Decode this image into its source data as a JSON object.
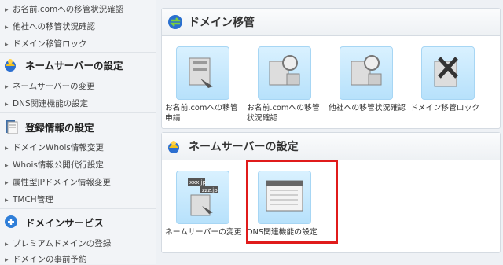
{
  "sidebar": {
    "top_items": [
      "お名前.comへの移管状況確認",
      "他社への移管状況確認",
      "ドメイン移管ロック"
    ],
    "sections": [
      {
        "heading": "ネームサーバーの設定",
        "items": [
          "ネームサーバーの変更",
          "DNS関連機能の設定"
        ]
      },
      {
        "heading": "登録情報の設定",
        "items": [
          "ドメインWhois情報変更",
          "Whois情報公開代行設定",
          "属性型JPドメイン情報変更",
          "TMCH管理"
        ]
      },
      {
        "heading": "ドメインサービス",
        "items": [
          "プレミアムドメインの登録",
          "ドメインの事前予約"
        ]
      }
    ]
  },
  "main": {
    "transfer": {
      "title": "ドメイン移管",
      "tiles": [
        {
          "label": "お名前.comへの移管申請"
        },
        {
          "label": "お名前.comへの移管状況確認"
        },
        {
          "label": "他社への移管状況確認"
        },
        {
          "label": "ドメイン移管ロック"
        }
      ]
    },
    "nameserver": {
      "title": "ネームサーバーの設定",
      "tiles": [
        {
          "label": "ネームサーバーの変更",
          "icon_text_1": "xxx.jp",
          "icon_text_2": "zzz.jp"
        },
        {
          "label": "DNS関連機能の設定"
        }
      ]
    }
  },
  "colors": {
    "highlight": "#e01b1b",
    "accent": "#2f9bd6"
  }
}
